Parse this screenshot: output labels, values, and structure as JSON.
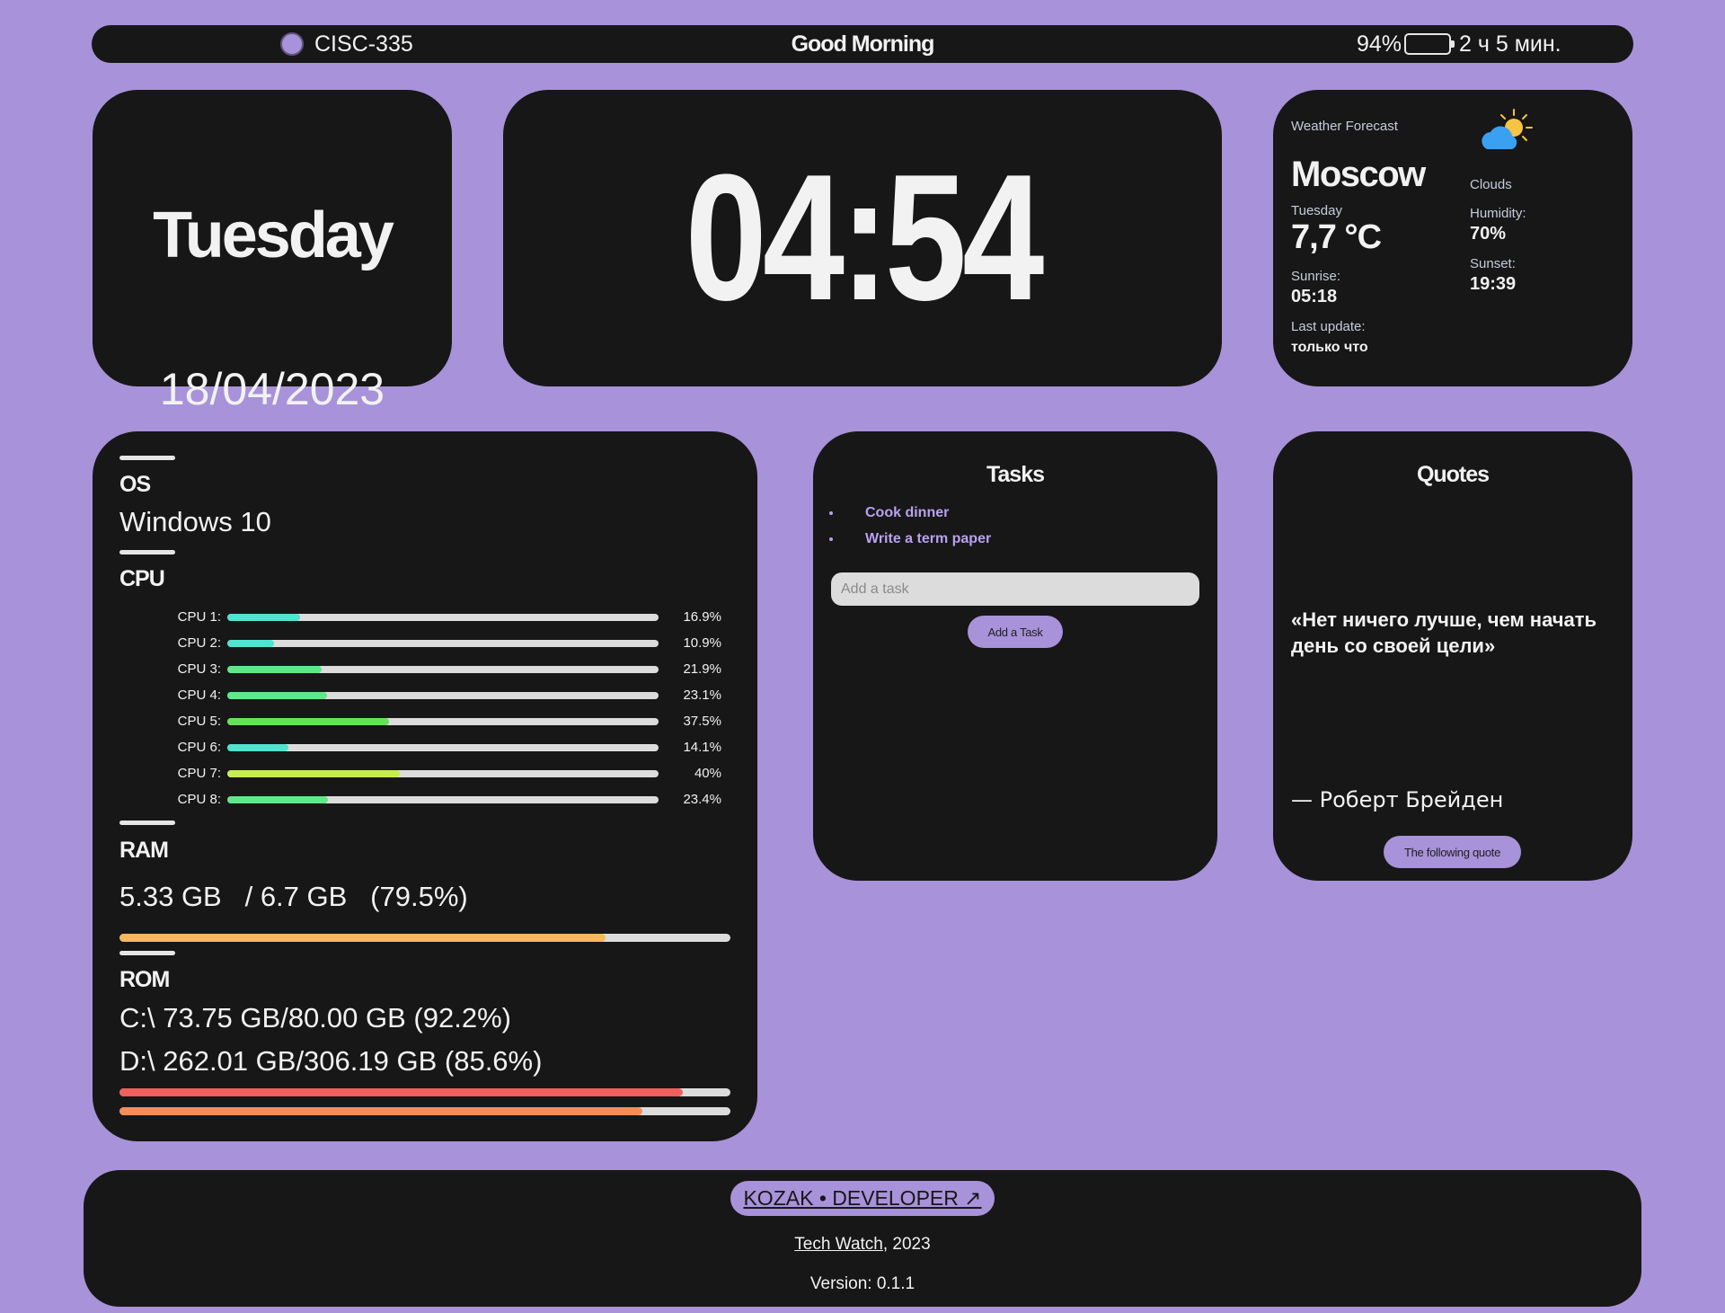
{
  "topbar": {
    "host": "CISC-335",
    "greeting": "Good Morning",
    "battery_percent": "94%",
    "battery_level": 94,
    "battery_time": "2 ч 5 мин."
  },
  "date": {
    "day": "Tuesday",
    "date": "18/04/2023"
  },
  "clock": {
    "time": "04:54"
  },
  "weather": {
    "header": "Weather Forecast",
    "city": "Moscow",
    "condition": "Clouds",
    "day": "Tuesday",
    "temperature": "7,7 °C",
    "humidity_label": "Humidity:",
    "humidity": "70%",
    "sunrise_label": "Sunrise:",
    "sunrise": "05:18",
    "sunset_label": "Sunset:",
    "sunset": "19:39",
    "last_update_label": "Last update:",
    "last_update": "только что"
  },
  "system": {
    "os_label": "OS",
    "os": "Windows 10",
    "cpu_label": "CPU",
    "cpus": [
      {
        "label": "CPU 1:",
        "pct": "16.9%",
        "value": 16.9,
        "color": "#4fe3d0"
      },
      {
        "label": "CPU 2:",
        "pct": "10.9%",
        "value": 10.9,
        "color": "#4fe3d0"
      },
      {
        "label": "CPU 3:",
        "pct": "21.9%",
        "value": 21.9,
        "color": "#5ee88a"
      },
      {
        "label": "CPU 4:",
        "pct": "23.1%",
        "value": 23.1,
        "color": "#5ee88a"
      },
      {
        "label": "CPU 5:",
        "pct": "37.5%",
        "value": 37.5,
        "color": "#66e25a"
      },
      {
        "label": "CPU 6:",
        "pct": "14.1%",
        "value": 14.1,
        "color": "#4fe3d0"
      },
      {
        "label": "CPU 7:",
        "pct": "40%",
        "value": 40,
        "color": "#c9ec4e"
      },
      {
        "label": "CPU 8:",
        "pct": "23.4%",
        "value": 23.4,
        "color": "#5ee88a"
      }
    ],
    "ram_label": "RAM",
    "ram_used": "5.33 GB",
    "ram_total": "/ 6.7 GB",
    "ram_pct": "(79.5%)",
    "ram_value": 79.5,
    "ram_color": "#f5b85c",
    "rom_label": "ROM",
    "drives": [
      {
        "text": "C:\\ 73.75 GB/80.00 GB (92.2%)",
        "value": 92.2,
        "color": "#f0605c"
      },
      {
        "text": "D:\\ 262.01 GB/306.19 GB (85.6%)",
        "value": 85.6,
        "color": "#f78c5a"
      }
    ]
  },
  "tasks": {
    "title": "Tasks",
    "items": [
      "Cook dinner",
      "Write a term paper"
    ],
    "input_placeholder": "Add a task",
    "add_button": "Add a Task"
  },
  "quotes": {
    "title": "Quotes",
    "text": "«Нет ничего лучше, чем начать день со своей цели»",
    "author": "— Роберт Брейден",
    "next_button": "The following quote"
  },
  "footer": {
    "dev_link": "KOZAK • DEVELOPER ↗",
    "project": "Tech Watch",
    "year": ", 2023",
    "version": "Version: 0.1.1"
  },
  "colors": {
    "background": "#a892d9",
    "card": "#171717",
    "accent": "#a892d9",
    "task_text": "#b9a1f0"
  }
}
